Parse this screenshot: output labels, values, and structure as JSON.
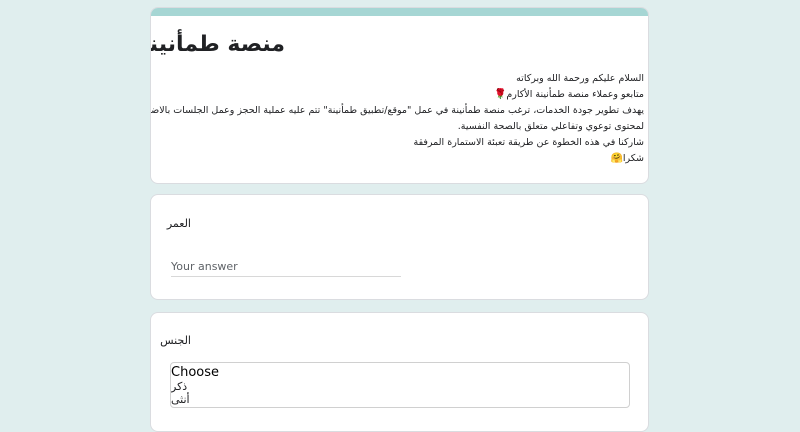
{
  "form": {
    "title": "منصة طمأنينة",
    "description": [
      "السلام عليكم ورحمة الله وبركاته",
      "متابعو وعملاء منصة طمأنينة الأكارم",
      "يهدف تطوير جودة الخدمات، ترغب منصة طمأنينة في عمل \"موقع/تطبيق طمأنينة\" تتم عليه عملية الحجز وعمل الجلسات بالاضافة",
      "لمحتوى توعوي وتفاعلي متعلق بالصحة النفسية.",
      "شاركنا في هذه الخطوة عن طريقة تعبئة الاستمارة المرفقة",
      "شكرا"
    ],
    "accent_color": "#a6d6d4",
    "background_color": "#e0eeee",
    "icons": {
      "rose": "rose-emoji",
      "hug": "hugging-face-emoji"
    }
  },
  "questions": {
    "age": {
      "label": "العمر",
      "placeholder": "Your answer",
      "value": ""
    },
    "gender": {
      "label": "الجنس",
      "options": [
        "Choose",
        "ذكر",
        "أنثى"
      ]
    }
  }
}
